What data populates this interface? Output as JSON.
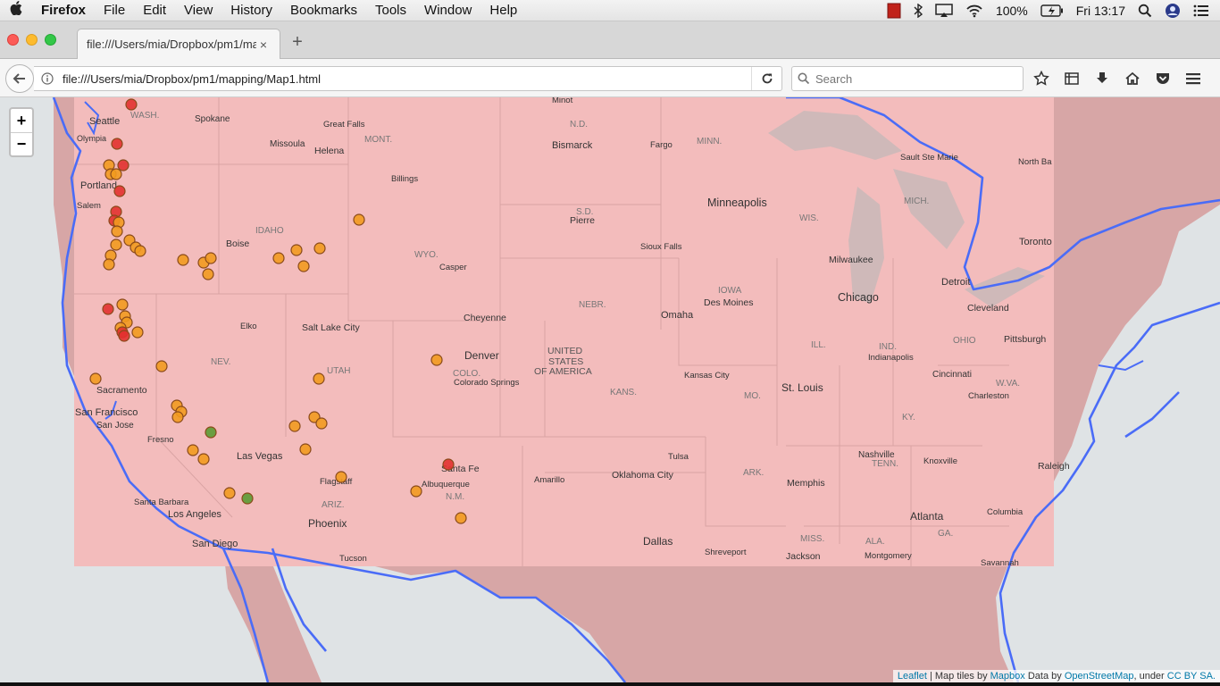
{
  "menubar": {
    "app_name": "Firefox",
    "items": [
      "File",
      "Edit",
      "View",
      "History",
      "Bookmarks",
      "Tools",
      "Window",
      "Help"
    ],
    "battery": "100%",
    "clock": "Fri 13:17"
  },
  "tab": {
    "title": "file:///Users/mia/Dropbox/pm1/ma",
    "close": "×",
    "new_tab": "+"
  },
  "navbar": {
    "url": "file:///Users/mia/Dropbox/pm1/mapping/Map1.html",
    "search_placeholder": "Search"
  },
  "map": {
    "zoom_in": "+",
    "zoom_out": "−",
    "attribution": {
      "leaflet": "Leaflet",
      "sep1": " | Map tiles by ",
      "mapbox": "Mapbox",
      "sep2": " Data by ",
      "osm": "OpenStreetMap",
      "sep3": ", under ",
      "license": "CC BY SA."
    },
    "labels": [
      "Seattle",
      "WASH.",
      "Spokane",
      "Olympia",
      "Great Falls",
      "Missoula",
      "MONT.",
      "Helena",
      "Minot",
      "N.D.",
      "Bismarck",
      "Fargo",
      "MINN.",
      "Portland",
      "Billings",
      "Salem",
      "Minneapolis",
      "S.D.",
      "Pierre",
      "WIS.",
      "MICH.",
      "IDAHO",
      "Boise",
      "WYO.",
      "Casper",
      "Sioux Falls",
      "Milwaukee",
      "Toronto",
      "Detroit",
      "IOWA",
      "Des Moines",
      "Chicago",
      "NEBR.",
      "Omaha",
      "Cheyenne",
      "Cleveland",
      "OHIO",
      "Pittsburgh",
      "Elko",
      "Salt Lake City",
      "NEV.",
      "UTAH",
      "Denver",
      "COLO.",
      "Colorado Springs",
      "UNITED",
      "STATES",
      "OF AMERICA",
      "KANS.",
      "Kansas City",
      "MO.",
      "ILL.",
      "IND.",
      "Indianapolis",
      "Cincinnati",
      "W.VA.",
      "Charleston",
      "St. Louis",
      "Sacramento",
      "San Francisco",
      "San Jose",
      "Fresno",
      "Las Vegas",
      "Flagstaff",
      "Santa Fe",
      "Albuquerque",
      "N.M.",
      "Amarillo",
      "Tulsa",
      "Oklahoma City",
      "ARK.",
      "Memphis",
      "Nashville",
      "TENN.",
      "Knoxville",
      "KY.",
      "ARIZ.",
      "Phoenix",
      "Santa Barbara",
      "Los Angeles",
      "San Diego",
      "Tucson",
      "Dallas",
      "Shreveport",
      "Jackson",
      "MISS.",
      "ALA.",
      "Montgomery",
      "Atlanta",
      "GA.",
      "Columbia",
      "Savannah",
      "Sault Ste Marie",
      "North Ba",
      "Raleigh"
    ],
    "marker_colors": {
      "red": "#e2312f",
      "orange": "#f29a1f",
      "green": "#5b9a33"
    },
    "overlay_color": "#f4a8a8",
    "border_color": "#4a6cf7"
  }
}
